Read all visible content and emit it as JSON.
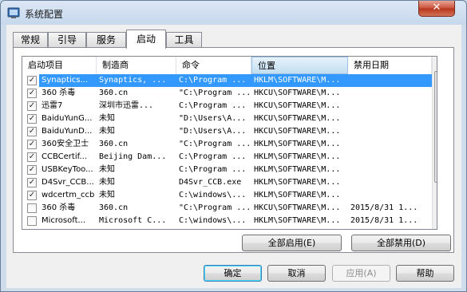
{
  "window": {
    "title": "系统配置",
    "close_glyph": "✕"
  },
  "tabs": [
    {
      "label": "常规"
    },
    {
      "label": "引导"
    },
    {
      "label": "服务"
    },
    {
      "label": "启动",
      "active": true
    },
    {
      "label": "工具"
    }
  ],
  "columns": [
    "启动项目",
    "制造商",
    "命令",
    "位置",
    "禁用日期"
  ],
  "rows": [
    {
      "checked": true,
      "item": "Synaptics...",
      "maker": "Synaptics, ...",
      "command": "C:\\Program ...",
      "location": "HKLM\\SOFTWARE\\M...",
      "date": "",
      "selected": true
    },
    {
      "checked": true,
      "item": "360 杀毒",
      "maker": "360.cn",
      "command": "\"C:\\Program ...",
      "location": "HKCU\\SOFTWARE\\M...",
      "date": ""
    },
    {
      "checked": true,
      "item": "迅雷7",
      "maker": "深圳市迅雷...",
      "command": "C:\\Program ...",
      "location": "HKCU\\SOFTWARE\\M...",
      "date": ""
    },
    {
      "checked": true,
      "item": "BaiduYunG...",
      "maker": "未知",
      "command": "\"D:\\Users\\A...",
      "location": "HKCU\\SOFTWARE\\M...",
      "date": ""
    },
    {
      "checked": true,
      "item": "BaiduYunD...",
      "maker": "未知",
      "command": "\"D:\\Users\\A...",
      "location": "HKCU\\SOFTWARE\\M...",
      "date": ""
    },
    {
      "checked": true,
      "item": "360安全卫士",
      "maker": "360.cn",
      "command": "\"C:\\Program ...",
      "location": "HKLM\\SOFTWARE\\M...",
      "date": ""
    },
    {
      "checked": true,
      "item": "CCBCertif...",
      "maker": "Beijing Dam...",
      "command": "C:\\Program ...",
      "location": "HKLM\\SOFTWARE\\M...",
      "date": ""
    },
    {
      "checked": true,
      "item": "USBKeyToo...",
      "maker": "未知",
      "command": "C:\\Program ...",
      "location": "HKLM\\SOFTWARE\\M...",
      "date": ""
    },
    {
      "checked": true,
      "item": "D4Svr_CCB...",
      "maker": "未知",
      "command": "D4Svr_CCB.exe",
      "location": "HKLM\\SOFTWARE\\M...",
      "date": ""
    },
    {
      "checked": true,
      "item": "wdcertm_ccb",
      "maker": "未知",
      "command": "C:\\windows\\...",
      "location": "HKLM\\SOFTWARE\\M...",
      "date": ""
    },
    {
      "checked": false,
      "item": "360 杀毒",
      "maker": "360.cn",
      "command": "\"C:\\Program ...",
      "location": "HKCU\\SOFTWARE\\M...",
      "date": "2015/8/31 1..."
    },
    {
      "checked": false,
      "item": "Microsoft...",
      "maker": "Microsoft C...",
      "command": "C:\\windows\\...",
      "location": "HKLM\\SOFTWARE\\M...",
      "date": "2015/8/31 1..."
    }
  ],
  "check_glyph": "✓",
  "scroll_up_glyph": "▲",
  "scroll_down_glyph": "▼",
  "buttons": {
    "enable_all": "全部启用(E)",
    "disable_all": "全部禁用(D)",
    "ok": "确定",
    "cancel": "取消",
    "apply": "应用(A)",
    "help": "帮助"
  }
}
